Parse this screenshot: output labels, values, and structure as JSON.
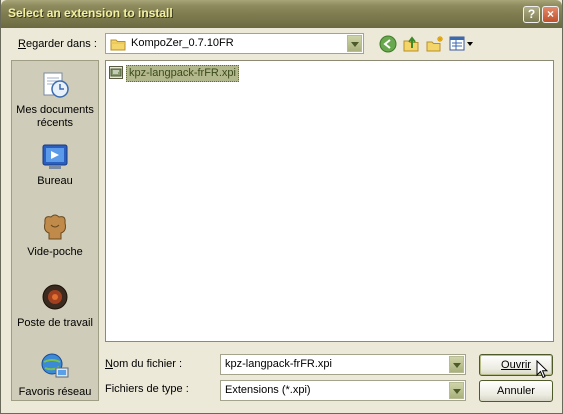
{
  "window": {
    "title": "Select an extension to install",
    "help_button": "?",
    "close_button": "×"
  },
  "lookin": {
    "label": "Regarder dans :",
    "value": "KompoZer_0.7.10FR"
  },
  "places": [
    {
      "label": "Mes documents récents"
    },
    {
      "label": "Bureau"
    },
    {
      "label": "Vide-poche"
    },
    {
      "label": "Poste de travail"
    },
    {
      "label": "Favoris réseau"
    }
  ],
  "files": [
    {
      "name": "kpz-langpack-frFR.xpi",
      "selected": true
    }
  ],
  "filename": {
    "label": "Nom du fichier :",
    "value": "kpz-langpack-frFR.xpi"
  },
  "filetype": {
    "label": "Fichiers de type :",
    "value": "Extensions (*.xpi)"
  },
  "buttons": {
    "open": "Ouvrir",
    "cancel": "Annuler"
  },
  "colors": {
    "title_bar": "#7d7b4e",
    "title_text": "#f4f0a0",
    "dialog_bg": "#ece9d8",
    "places_bg": "#cfccb9",
    "selection": "#b3b88c"
  }
}
